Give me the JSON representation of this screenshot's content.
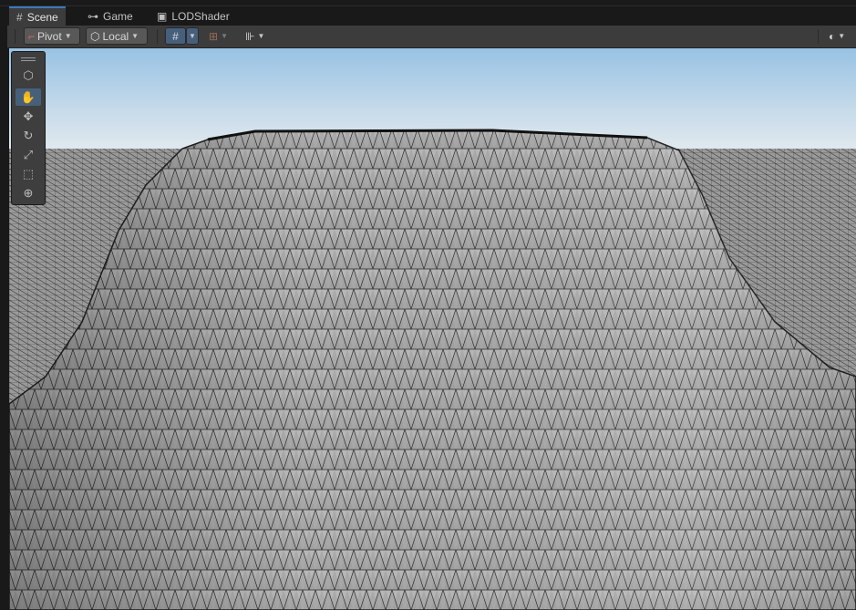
{
  "tabs": [
    {
      "label": "Scene",
      "icon": "grid-icon",
      "glyph": "#",
      "active": true
    },
    {
      "label": "Game",
      "icon": "gamepad-icon",
      "glyph": "🎮",
      "active": false
    },
    {
      "label": "LODShader",
      "icon": "shader-icon",
      "glyph": "▣",
      "active": false
    }
  ],
  "toolbar": {
    "pivot_label": "Pivot",
    "local_label": "Local"
  },
  "tools": [
    {
      "name": "view-cube-icon",
      "glyph": "⬡",
      "active": false
    },
    {
      "name": "hand-tool-icon",
      "glyph": "✋",
      "active": true
    },
    {
      "name": "move-tool-icon",
      "glyph": "✥",
      "active": false
    },
    {
      "name": "rotate-tool-icon",
      "glyph": "↻",
      "active": false
    },
    {
      "name": "scale-tool-icon",
      "glyph": "⤢",
      "active": false
    },
    {
      "name": "rect-tool-icon",
      "glyph": "⬚",
      "active": false
    },
    {
      "name": "transform-tool-icon",
      "glyph": "⊕",
      "active": false
    }
  ],
  "colors": {
    "accent": "#3a79bb",
    "sky_top": "#98c2e4",
    "sky_bottom": "#e8eef2",
    "mesh_fill": "#a9a9a9",
    "wire": "#2b2b2b"
  }
}
